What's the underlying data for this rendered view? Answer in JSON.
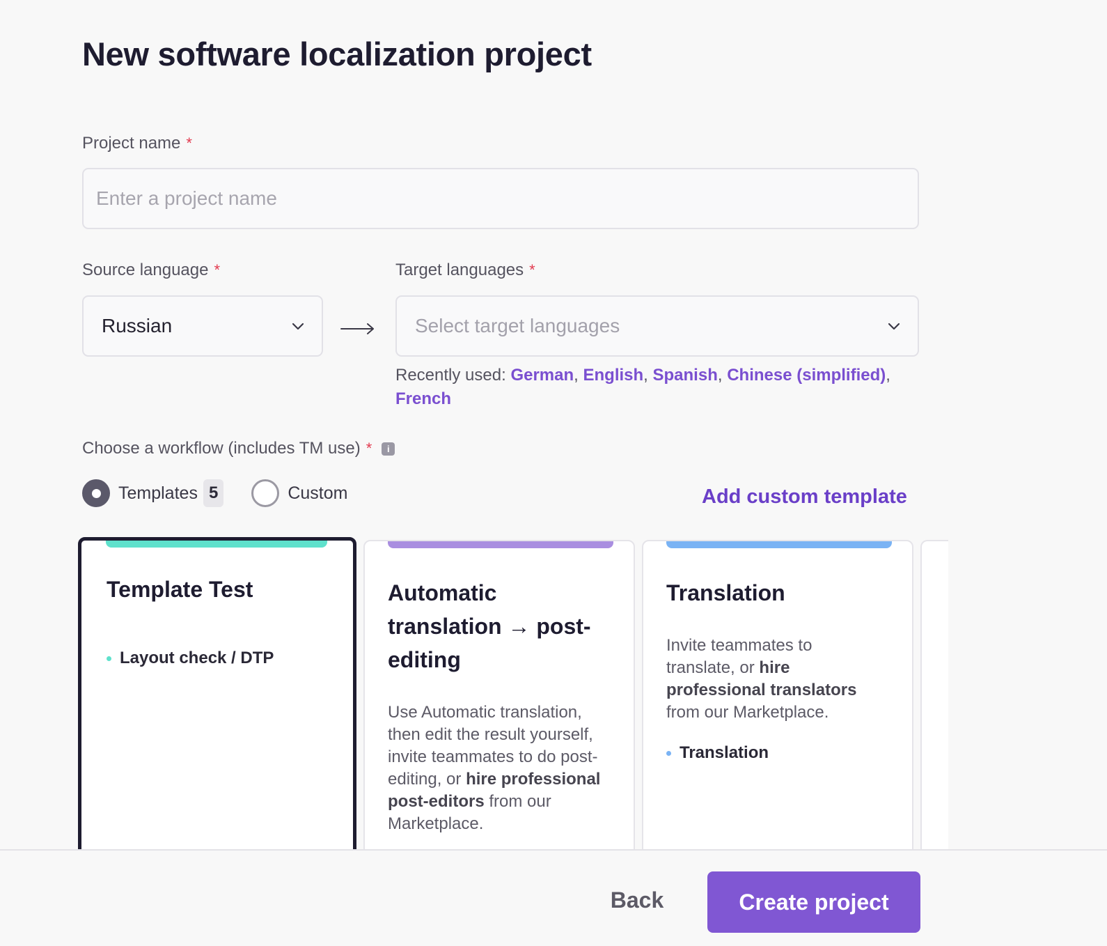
{
  "page": {
    "title": "New software localization project"
  },
  "project_name": {
    "label": "Project name",
    "required_mark": "*",
    "placeholder": "Enter a project name",
    "value": ""
  },
  "source_language": {
    "label": "Source language",
    "required_mark": "*",
    "value": "Russian"
  },
  "target_languages": {
    "label": "Target languages",
    "required_mark": "*",
    "placeholder": "Select target languages",
    "recent_prefix": "Recently used:",
    "recent": [
      "German",
      "English",
      "Spanish",
      "Chinese (simplified)",
      "French"
    ]
  },
  "workflow": {
    "label": "Choose a workflow (includes TM use)",
    "required_mark": "*",
    "info_icon": "i",
    "options": [
      {
        "label": "Templates",
        "count": "5",
        "checked": true
      },
      {
        "label": "Custom",
        "checked": false
      }
    ],
    "add_template_label": "Add custom template"
  },
  "cards": [
    {
      "title": "Template Test",
      "accent": "#5fe1cc",
      "selected": true,
      "bullets": [
        "Layout check / DTP"
      ],
      "bullet_color": "#5fe1cc"
    },
    {
      "title": "Automatic translation → post-editing",
      "accent": "#a98ee0",
      "selected": false,
      "desc_parts": [
        {
          "text": "Use Automatic translation, then edit the result yourself, invite teammates to do post-editing, or ",
          "bold": false
        },
        {
          "text": "hire professional post-editors",
          "bold": true
        },
        {
          "text": " from our Marketplace.",
          "bold": false
        }
      ]
    },
    {
      "title": "Translation",
      "accent": "#7ab3f4",
      "selected": false,
      "desc_parts": [
        {
          "text": "Invite teammates to translate, or ",
          "bold": false
        },
        {
          "text": "hire professional translators",
          "bold": true
        },
        {
          "text": " from our Marketplace.",
          "bold": false
        }
      ],
      "bullets": [
        "Translation"
      ],
      "bullet_color": "#7ab3f4"
    }
  ],
  "footer": {
    "back_label": "Back",
    "create_label": "Create project"
  },
  "colors": {
    "accent_purple": "#8057d3",
    "link_purple": "#7a4fd0",
    "required_red": "#e23a4f"
  }
}
